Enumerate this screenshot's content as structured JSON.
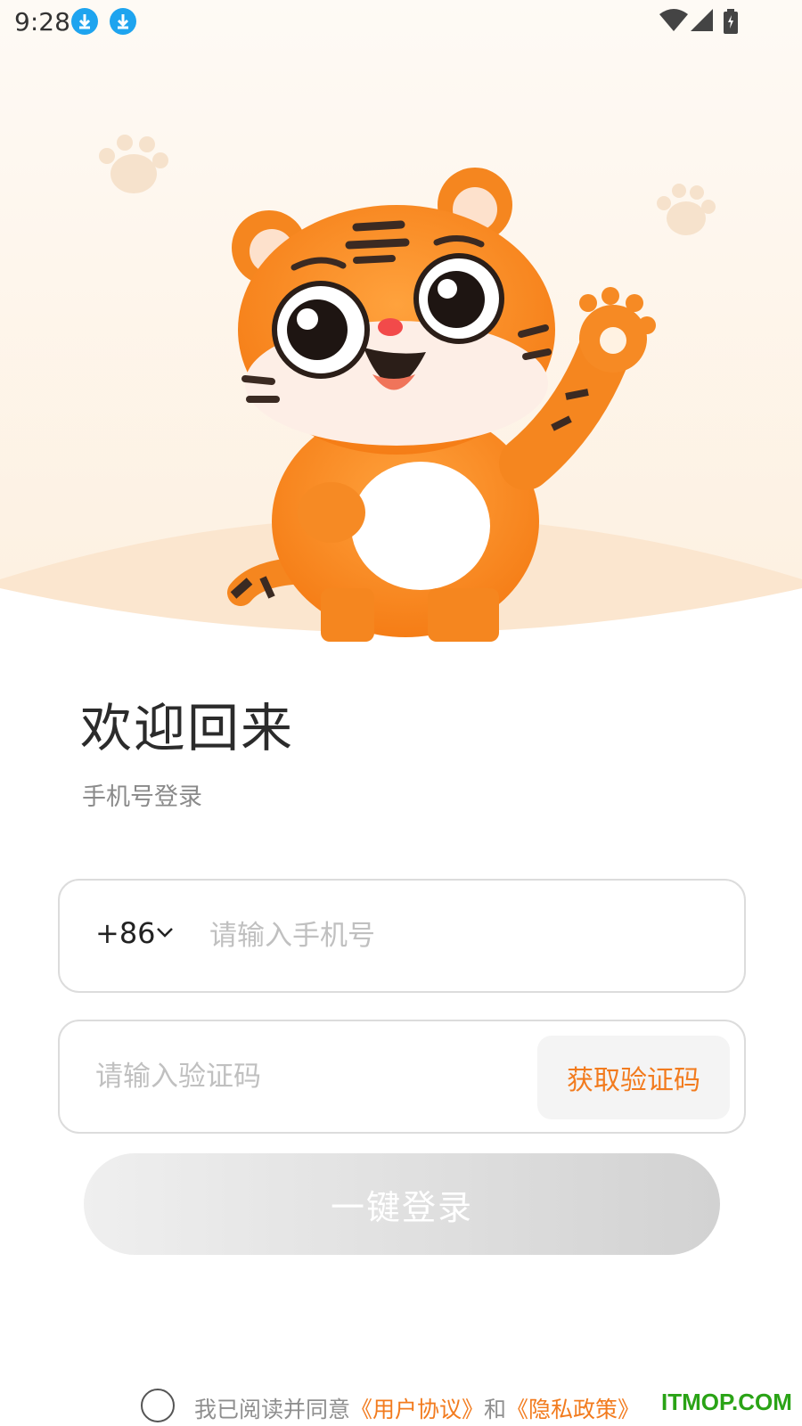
{
  "status_bar": {
    "time": "9:28"
  },
  "welcome": {
    "title": "欢迎回来",
    "subtitle": "手机号登录"
  },
  "phone_field": {
    "country_code": "+86",
    "placeholder": "请输入手机号",
    "value": ""
  },
  "code_field": {
    "placeholder": "请输入验证码",
    "value": "",
    "get_code_label": "获取验证码"
  },
  "login_button": {
    "label": "一键登录"
  },
  "agreement": {
    "prefix": "我已阅读并同意",
    "user_agreement": "《用户协议》",
    "and": "和",
    "privacy_policy": "《隐私政策》",
    "checked": false
  },
  "watermark": "ITMOP.COM",
  "colors": {
    "accent": "#f27b1e",
    "tiger": "#f5861f",
    "hero_bg": "#fdf1e4"
  }
}
